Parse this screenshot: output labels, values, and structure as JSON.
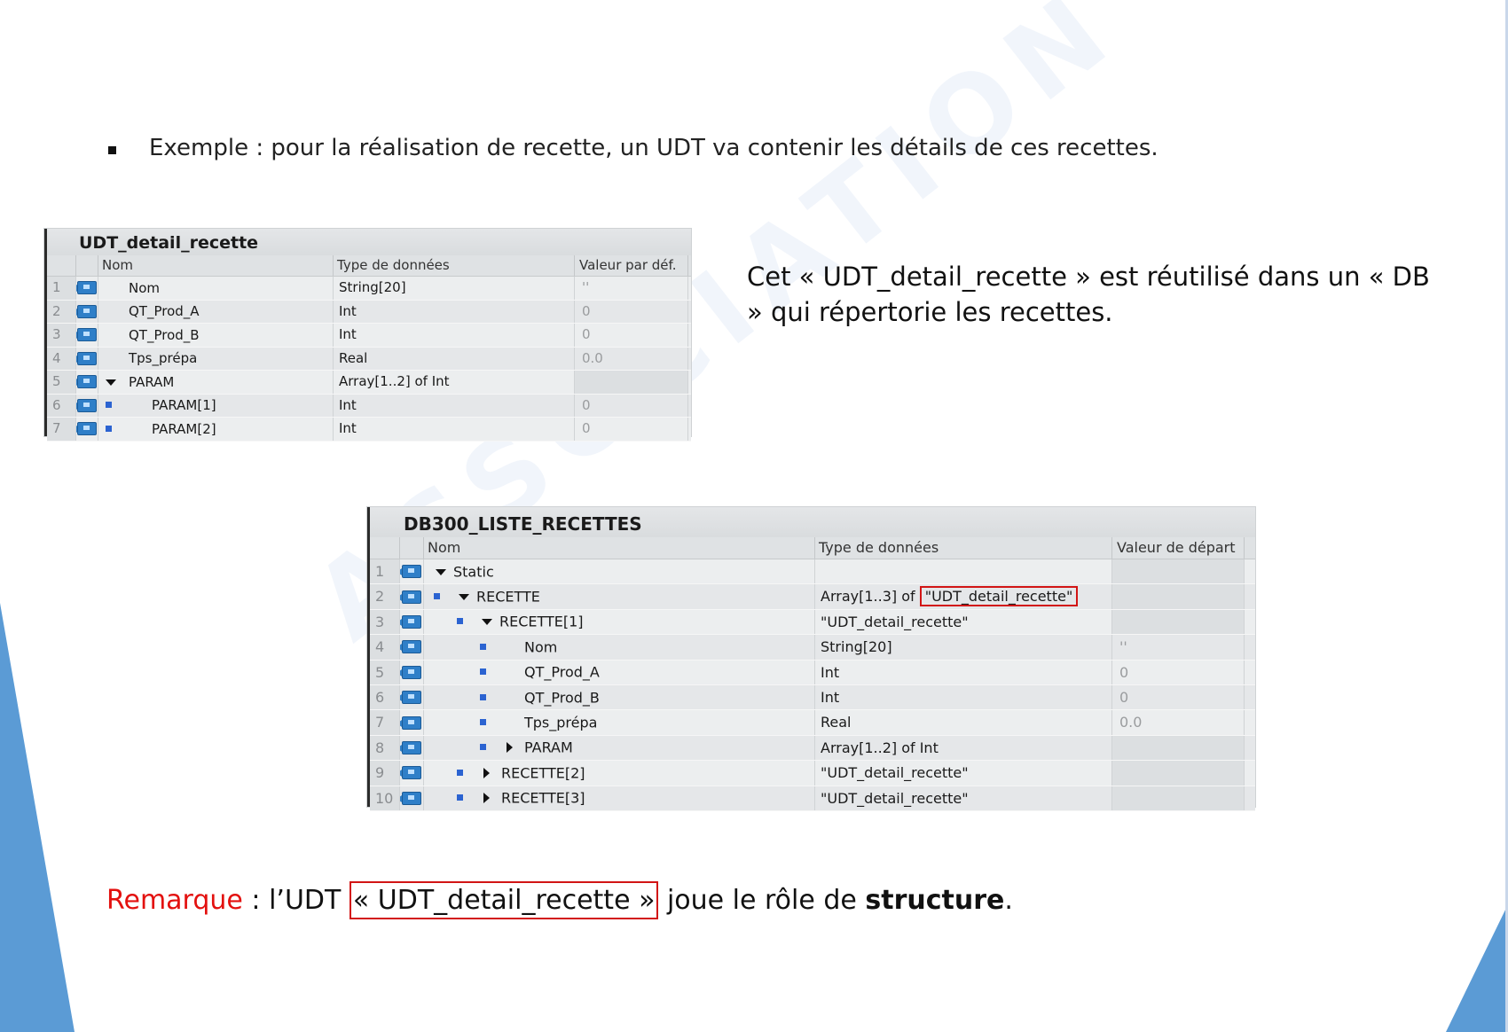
{
  "bullet": "Exemple : pour la réalisation de recette, un UDT va contenir les détails de ces recettes.",
  "side_text": "Cet « UDT_detail_recette » est réutilisé dans un « DB » qui répertorie les recettes.",
  "remark": {
    "label": "Remarque",
    "part1": " : l’UDT ",
    "boxed": "« UDT_detail_recette »",
    "part2": " joue le rôle de ",
    "bold": "structure",
    "end": "."
  },
  "colors": {
    "accent_blue": "#5b9bd5",
    "highlight_red": "#d21515",
    "remark_red": "#e3110f"
  },
  "udt_table": {
    "title": "UDT_detail_recette",
    "headers": {
      "name": "Nom",
      "type": "Type de données",
      "default": "Valeur par déf."
    },
    "rows": [
      {
        "num": "1",
        "name": "Nom",
        "type": "String[20]",
        "value": "''"
      },
      {
        "num": "2",
        "name": "QT_Prod_A",
        "type": "Int",
        "value": "0"
      },
      {
        "num": "3",
        "name": "QT_Prod_B",
        "type": "Int",
        "value": "0"
      },
      {
        "num": "4",
        "name": "Tps_prépa",
        "type": "Real",
        "value": "0.0"
      },
      {
        "num": "5",
        "name": "PARAM",
        "type": "Array[1..2] of Int",
        "value": ""
      },
      {
        "num": "6",
        "name": "PARAM[1]",
        "type": "Int",
        "value": "0"
      },
      {
        "num": "7",
        "name": "PARAM[2]",
        "type": "Int",
        "value": "0"
      }
    ]
  },
  "db_table": {
    "title": "DB300_LISTE_RECETTES",
    "headers": {
      "name": "Nom",
      "type": "Type de données",
      "start": "Valeur de départ"
    },
    "rows": [
      {
        "num": "1",
        "name": "Static",
        "type": "",
        "value": ""
      },
      {
        "num": "2",
        "name": "RECETTE",
        "type_prefix": "Array[1..3] of ",
        "type_boxed": "\"UDT_detail_recette\"",
        "value": ""
      },
      {
        "num": "3",
        "name": "RECETTE[1]",
        "type": "\"UDT_detail_recette\"",
        "value": ""
      },
      {
        "num": "4",
        "name": "Nom",
        "type": "String[20]",
        "value": "''"
      },
      {
        "num": "5",
        "name": "QT_Prod_A",
        "type": "Int",
        "value": "0"
      },
      {
        "num": "6",
        "name": "QT_Prod_B",
        "type": "Int",
        "value": "0"
      },
      {
        "num": "7",
        "name": "Tps_prépa",
        "type": "Real",
        "value": "0.0"
      },
      {
        "num": "8",
        "name": "PARAM",
        "type": "Array[1..2] of Int",
        "value": ""
      },
      {
        "num": "9",
        "name": "RECETTE[2]",
        "type": "\"UDT_detail_recette\"",
        "value": ""
      },
      {
        "num": "10",
        "name": "RECETTE[3]",
        "type": "\"UDT_detail_recette\"",
        "value": ""
      }
    ]
  }
}
